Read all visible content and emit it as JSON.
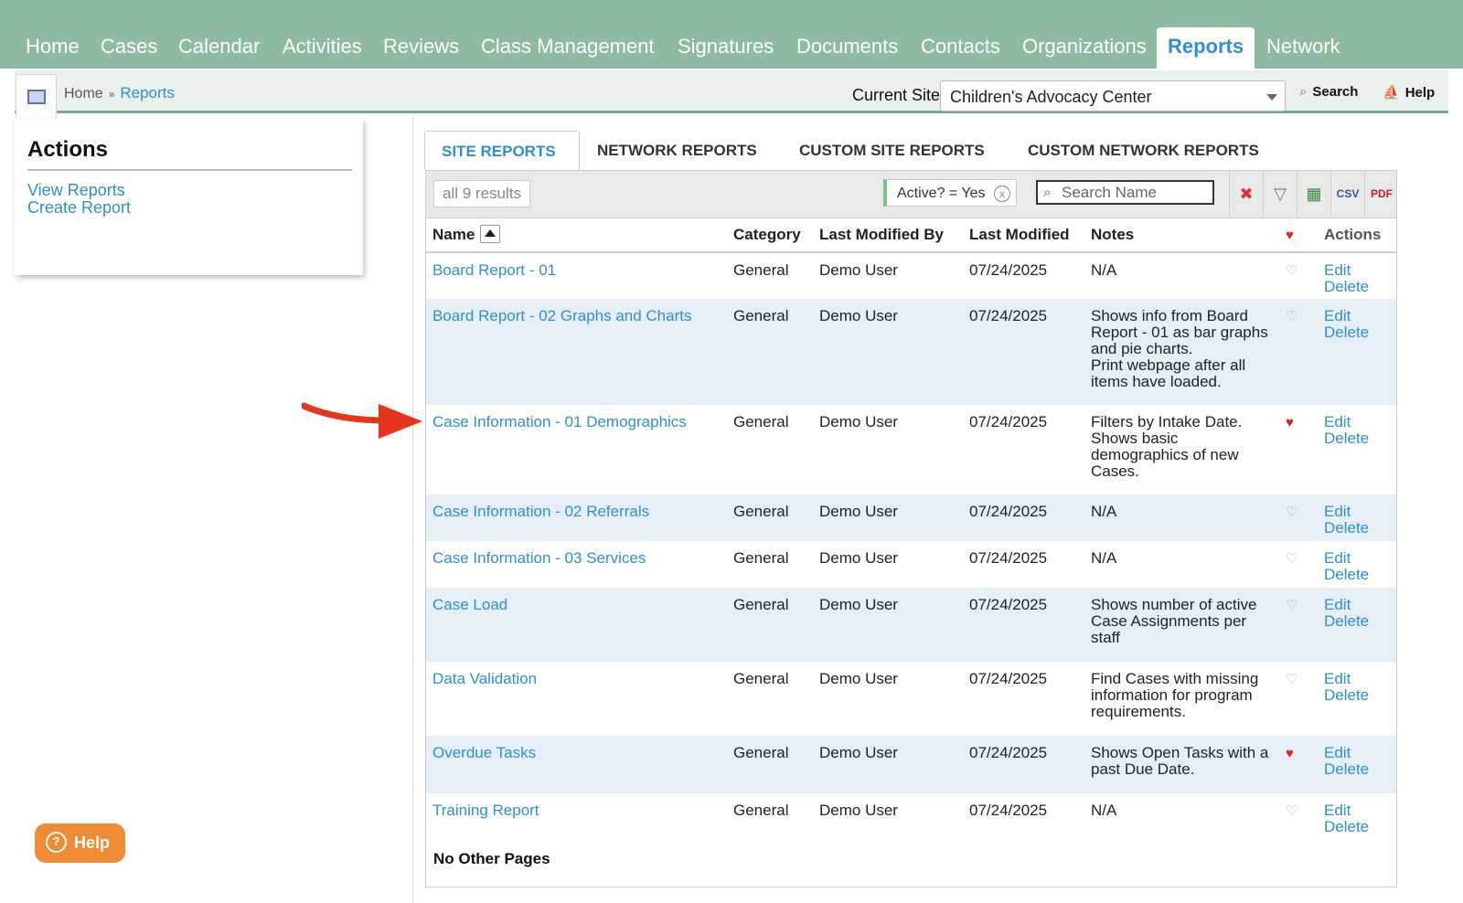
{
  "nav": {
    "items": [
      {
        "label": "Home"
      },
      {
        "label": "Cases"
      },
      {
        "label": "Calendar"
      },
      {
        "label": "Activities"
      },
      {
        "label": "Reviews"
      },
      {
        "label": "Class Management"
      },
      {
        "label": "Signatures"
      },
      {
        "label": "Documents"
      },
      {
        "label": "Contacts"
      },
      {
        "label": "Organizations"
      },
      {
        "label": "Reports",
        "active": true
      },
      {
        "label": "Network"
      }
    ]
  },
  "breadcrumb": {
    "home": "Home",
    "sep": "»",
    "current": "Reports"
  },
  "header": {
    "site_label": "Current Site",
    "site_value": "Children's Advocacy Center",
    "search_label": "Search",
    "help_label": "Help"
  },
  "actions": {
    "title": "Actions",
    "links": [
      "View Reports",
      "Create Report"
    ]
  },
  "tabs": [
    "SITE REPORTS",
    "NETWORK REPORTS",
    "CUSTOM SITE REPORTS",
    "CUSTOM NETWORK REPORTS"
  ],
  "toolbar": {
    "results": "all 9 results",
    "filter": "Active? = Yes",
    "filter_clear": "x",
    "search_placeholder": "Search Name",
    "icons": [
      "clear-filter-icon",
      "filter-icon",
      "excel-export-icon",
      "csv-export-icon",
      "pdf-export-icon"
    ]
  },
  "columns": {
    "name": "Name",
    "category": "Category",
    "modified_by": "Last Modified By",
    "modified": "Last Modified",
    "notes": "Notes",
    "actions": "Actions"
  },
  "rows": [
    {
      "name": "Board Report - 01",
      "category": "General",
      "by": "Demo User",
      "date": "07/24/2025",
      "notes": [
        "N/A"
      ],
      "fav": false
    },
    {
      "name": "Board Report - 02 Graphs and Charts",
      "category": "General",
      "by": "Demo User",
      "date": "07/24/2025",
      "notes": [
        "Shows info from Board",
        "Report - 01 as bar graphs",
        "and pie charts.",
        "Print webpage after all",
        "items have loaded."
      ],
      "fav": false
    },
    {
      "name": "Case Information - 01 Demographics",
      "category": "General",
      "by": "Demo User",
      "date": "07/24/2025",
      "notes": [
        "Filters by Intake Date.",
        "Shows basic",
        "demographics of new",
        "Cases."
      ],
      "fav": true
    },
    {
      "name": "Case Information - 02 Referrals",
      "category": "General",
      "by": "Demo User",
      "date": "07/24/2025",
      "notes": [
        "N/A"
      ],
      "fav": false
    },
    {
      "name": "Case Information - 03 Services",
      "category": "General",
      "by": "Demo User",
      "date": "07/24/2025",
      "notes": [
        "N/A"
      ],
      "fav": false
    },
    {
      "name": "Case Load",
      "category": "General",
      "by": "Demo User",
      "date": "07/24/2025",
      "notes": [
        "Shows number of active",
        "Case Assignments per",
        "staff"
      ],
      "fav": false
    },
    {
      "name": "Data Validation",
      "category": "General",
      "by": "Demo User",
      "date": "07/24/2025",
      "notes": [
        "Find Cases with missing",
        "information for program",
        "requirements."
      ],
      "fav": false
    },
    {
      "name": "Overdue Tasks",
      "category": "General",
      "by": "Demo User",
      "date": "07/24/2025",
      "notes": [
        "Shows Open Tasks with a",
        "past Due Date."
      ],
      "fav": true
    },
    {
      "name": "Training Report",
      "category": "General",
      "by": "Demo User",
      "date": "07/24/2025",
      "notes": [
        "N/A"
      ],
      "fav": false
    }
  ],
  "row_actions": {
    "edit": "Edit",
    "delete": "Delete"
  },
  "footer": {
    "pages": "No Other Pages"
  },
  "help_button": "Help",
  "colors": {
    "nav_bg": "#8cbaa3",
    "link": "#2f8fcf",
    "row_alt": "#e6eef6",
    "help_bg": "#ef8b34",
    "arrow": "#e8341c"
  }
}
